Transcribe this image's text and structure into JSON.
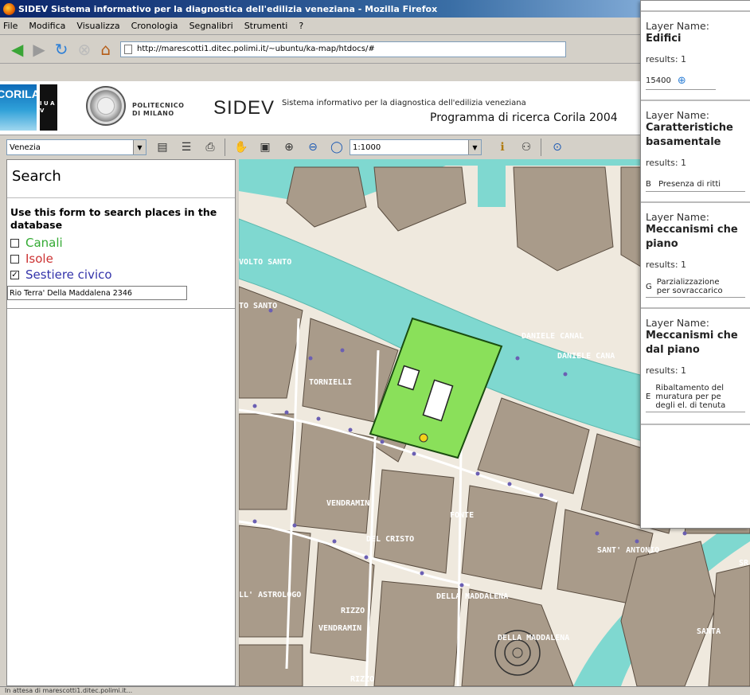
{
  "window": {
    "title": "SIDEV Sistema informativo per la diagnostica dell'edilizia veneziana - Mozilla Firefox"
  },
  "menu": [
    "File",
    "Modifica",
    "Visualizza",
    "Cronologia",
    "Segnalibri",
    "Strumenti",
    "?"
  ],
  "navbar": {
    "url": "http://marescotti1.ditec.polimi.it/~ubuntu/ka-map/htdocs/#"
  },
  "header": {
    "corila_logo": "CORILA",
    "iuav_letters": "I U A V",
    "polimi_line1": "POLITECNICO",
    "polimi_line2": "DI MILANO",
    "sidev": "SIDEV",
    "subtitle": "Sistema informativo per la diagnostica dell'edilizia veneziana",
    "program": "Programma di ricerca Corila 2004"
  },
  "toolbar": {
    "map_select": "Venezia",
    "scale_select": "1:1000"
  },
  "search": {
    "title": "Search",
    "description": "Use this form to search places in the database",
    "options": [
      {
        "label": "Canali",
        "checked": false,
        "color": "#33aa33"
      },
      {
        "label": "Isole",
        "checked": false,
        "color": "#cc3333"
      },
      {
        "label": "Sestiere civico",
        "checked": true,
        "color": "#3333aa"
      }
    ],
    "input_value": "Rio Terra' Della Maddalena 2346"
  },
  "map": {
    "street_labels": [
      "VOLTO SANTO",
      "TO SANTO",
      "DANIELE CANAL",
      "DANIELE CANA",
      "TORNIELLI",
      "VENDRAMIN",
      "FONTE",
      "DEL CRISTO",
      "SANT' ANTONIO",
      "LL' ASTROLOGO",
      "RIZZO",
      "VENDRAMIN",
      "DELLA MADDALENA",
      "DELLA MADDALENA",
      "SANTA",
      "RIZZO",
      "SR"
    ],
    "colors": {
      "water": "#7fd8d0",
      "buildings": "#a99b8a",
      "selection": "#8ae05a"
    }
  },
  "results": [
    {
      "label": "Layer Name:",
      "name": "Edifici",
      "count": "results: 1",
      "value": "15400",
      "key": ""
    },
    {
      "label": "Layer Name:",
      "name": "Caratteristiche basamentale",
      "count": "results: 1",
      "value": "Presenza di ritti",
      "key": "B"
    },
    {
      "label": "Layer Name:",
      "name": "Meccanismi che piano",
      "count": "results: 1",
      "value_lines": [
        "Parzializzazione",
        "per sovraccarico"
      ],
      "key": "G"
    },
    {
      "label": "Layer Name:",
      "name": "Meccanismi che dal piano",
      "count": "results: 1",
      "value_lines": [
        "Ribaltamento del",
        "muratura per pe",
        "degli el. di tenuta"
      ],
      "key": "E"
    }
  ],
  "status": "In attesa di marescotti1.ditec.polimi.it..."
}
